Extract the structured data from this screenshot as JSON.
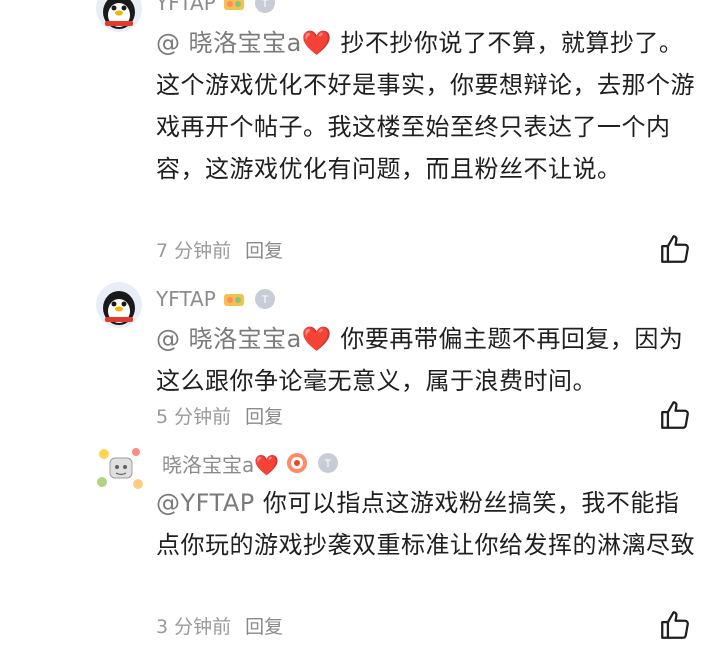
{
  "comments": [
    {
      "username": "YFTAP",
      "mention": "@ 晓洛宝宝a❤️",
      "text": "抄不抄你说了不算，就算抄了。这个游戏优化不好是事实，你要想辩论，去那个游戏再开个帖子。我这楼至始至终只表达了一个内容，这游戏优化有问题，而且粉丝不让说。",
      "time": "7 分钟前",
      "reply": "回复"
    },
    {
      "username": "YFTAP",
      "mention": "@ 晓洛宝宝a❤️",
      "text": "你要再带偏主题不再回复，因为这么跟你争论毫无意义，属于浪费时间。",
      "time": "5 分钟前",
      "reply": "回复"
    },
    {
      "username": "晓洛宝宝a❤️",
      "mention": "@YFTAP",
      "text": "你可以指点这游戏粉丝搞笑，我不能指点你玩的游戏抄袭双重标准让你给发挥的淋漓尽致",
      "time": "3 分钟前",
      "reply": "回复"
    }
  ],
  "icons": {
    "like": "thumbs-up-icon",
    "penguin_avatar": "penguin-avatar",
    "sticker_avatar": "sticker-avatar"
  },
  "colors": {
    "text": "#1f1f1f",
    "meta": "#8c8c8c",
    "heart": "#e53935"
  }
}
